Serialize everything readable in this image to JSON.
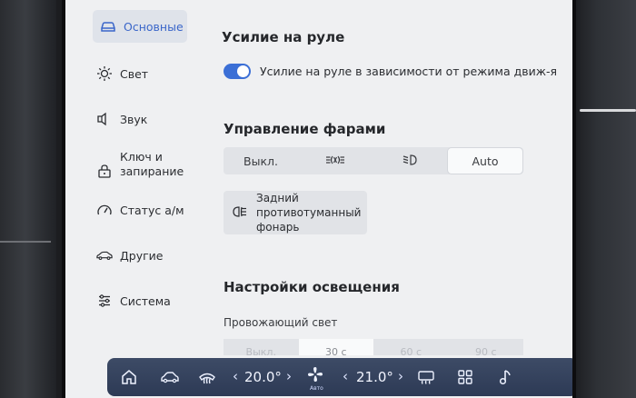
{
  "sidebar": {
    "items": [
      {
        "label": "Основные",
        "icon": "car-icon",
        "active": true
      },
      {
        "label": "Свет",
        "icon": "sun-icon"
      },
      {
        "label": "Звук",
        "icon": "speaker-icon"
      },
      {
        "label": "Ключ и\nзапирание",
        "icon": "lock-icon"
      },
      {
        "label": "Статус а/м",
        "icon": "gauge-icon"
      },
      {
        "label": "Другие",
        "icon": "car-side-icon"
      },
      {
        "label": "Система",
        "icon": "sliders-icon"
      }
    ]
  },
  "steering": {
    "title": "Усилие на руле",
    "toggle_label": "Усилие на руле в зависимости от режима движ-я",
    "toggle_on": true
  },
  "headlights": {
    "title": "Управление фарами",
    "options": [
      {
        "label": "Выкл."
      },
      {
        "icon": "parking-lights-icon"
      },
      {
        "icon": "low-beam-icon"
      },
      {
        "label": "Auto",
        "selected": true
      }
    ],
    "rear_fog": {
      "label": "Задний\nпротивотуманный\nфонарь",
      "icon": "rear-fog-icon"
    }
  },
  "lighting": {
    "title": "Настройки освещения",
    "follow_me_label": "Провожающий свет",
    "follow_me_options": [
      "Выкл.",
      "30 с",
      "60 с",
      "90 с"
    ],
    "follow_me_selected": 1
  },
  "climate": {
    "left_temp": "20.0°",
    "right_temp": "21.0°",
    "fan_mode": "Авто",
    "accent": "#2d3a55"
  }
}
